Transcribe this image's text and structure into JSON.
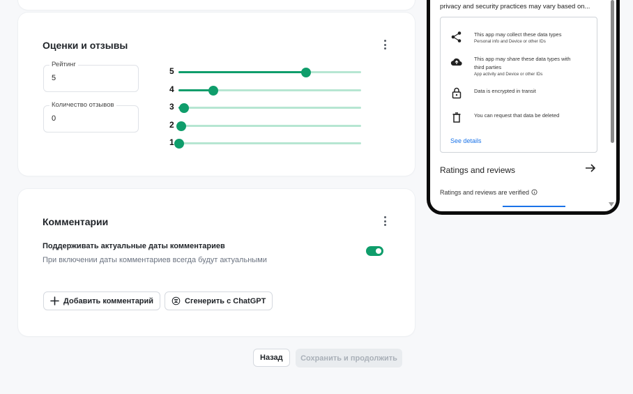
{
  "ratings_card": {
    "title": "Оценки и отзывы",
    "rating_field": {
      "label": "Рейтинг",
      "value": "5"
    },
    "reviews_count_field": {
      "label": "Количество отзывов",
      "value": "0"
    },
    "sliders": [
      {
        "label": "5",
        "level_percent": 70
      },
      {
        "label": "4",
        "level_percent": 19
      },
      {
        "label": "3",
        "level_percent": 3
      },
      {
        "label": "2",
        "level_percent": 1
      },
      {
        "label": "1",
        "level_percent": 0
      }
    ]
  },
  "comments_card": {
    "title": "Комментарии",
    "toggle_title": "Поддерживать актуальные даты комментариев",
    "toggle_description": "При включении даты комментариев всегда будут актуальными",
    "toggle_on": true,
    "add_comment_label": "Добавить комментарий",
    "generate_label": "Сгенерить с ChatGPT"
  },
  "footer": {
    "back_label": "Назад",
    "save_label": "Сохранить и продолжить"
  },
  "phone_preview": {
    "top_text": "privacy and security practices may vary based on...",
    "safety_items": [
      {
        "icon": "share-icon",
        "title": "This app may collect these data types",
        "subtitle": "Personal info and Device or other IDs"
      },
      {
        "icon": "cloud-upload-icon",
        "title": "This app may share these data types with",
        "title2": "third parties",
        "subtitle": "App activity and Device or other IDs"
      },
      {
        "icon": "lock-icon",
        "title": "Data is encrypted in transit"
      },
      {
        "icon": "trash-icon",
        "title": "You can request that data be deleted"
      }
    ],
    "see_details": "See details",
    "ratings_heading": "Ratings and reviews",
    "ratings_verified": "Ratings and reviews are verified",
    "accent_color": "#1a73e8"
  },
  "colors": {
    "brand_green": "#0f9d6b",
    "track_light": "#b6e6d2"
  }
}
